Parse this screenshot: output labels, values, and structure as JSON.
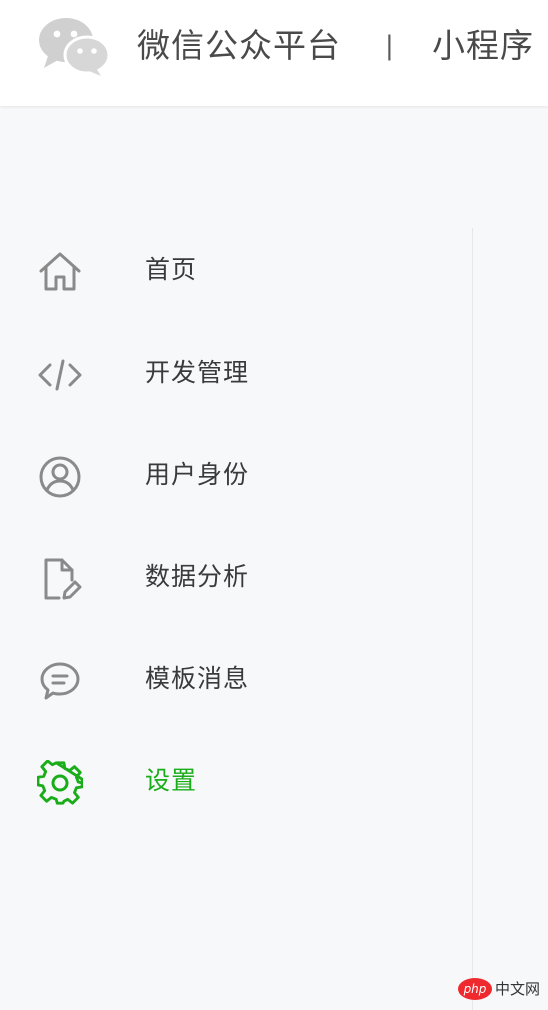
{
  "header": {
    "brand": "微信公众平台",
    "divider": "|",
    "product": "小程序"
  },
  "sidebar": {
    "items": [
      {
        "label": "首页",
        "icon": "home-icon",
        "active": false
      },
      {
        "label": "开发管理",
        "icon": "code-icon",
        "active": false
      },
      {
        "label": "用户身份",
        "icon": "user-circle-icon",
        "active": false
      },
      {
        "label": "数据分析",
        "icon": "document-edit-icon",
        "active": false
      },
      {
        "label": "模板消息",
        "icon": "chat-bubble-icon",
        "active": false
      },
      {
        "label": "设置",
        "icon": "gear-icon",
        "active": true
      }
    ]
  },
  "colors": {
    "active": "#1aad19",
    "icon": "#8a8a8a",
    "text": "#3a3a3a",
    "logo": "#cfcfcf"
  },
  "watermark": {
    "badge": "php",
    "text": "中文网"
  }
}
